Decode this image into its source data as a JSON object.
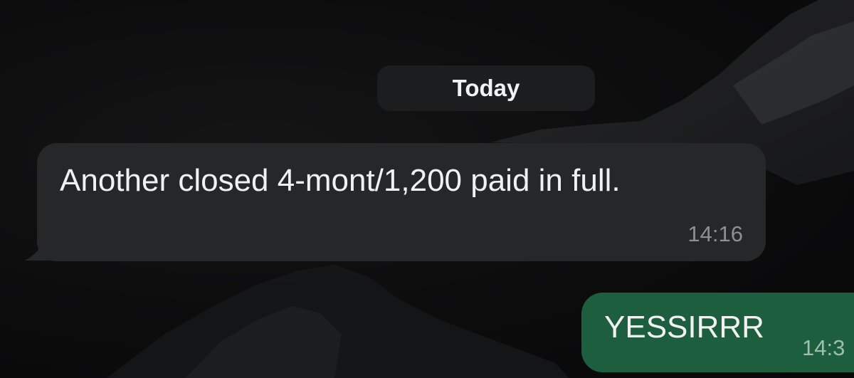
{
  "chat": {
    "date_separator": "Today",
    "messages": [
      {
        "direction": "incoming",
        "text": "Another closed 4-mont/1,200 paid in full.",
        "time": "14:16"
      },
      {
        "direction": "outgoing",
        "text": "YESSIRRR",
        "time": "14:3"
      }
    ]
  },
  "colors": {
    "background": "#0b0b0c",
    "incoming_bubble": "#262729",
    "outgoing_bubble": "#1d5e3e",
    "date_chip": "#1c1d1f"
  }
}
